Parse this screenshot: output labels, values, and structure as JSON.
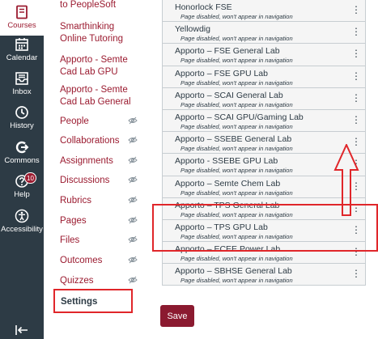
{
  "global_nav": {
    "items": [
      {
        "label": "Courses",
        "icon": "book-icon",
        "active": true
      },
      {
        "label": "Calendar",
        "icon": "calendar-icon"
      },
      {
        "label": "Inbox",
        "icon": "inbox-icon"
      },
      {
        "label": "History",
        "icon": "clock-icon"
      },
      {
        "label": "Commons",
        "icon": "commons-icon"
      },
      {
        "label": "Help",
        "icon": "help-icon",
        "badge": "10"
      },
      {
        "label": "Accessibility",
        "icon": "accessibility-icon"
      }
    ],
    "collapse_icon": "collapse-arrow-icon"
  },
  "course_nav": {
    "items": [
      {
        "label": "to PeopleSoft"
      },
      {
        "label": "Smarthinking Online Tutoring"
      },
      {
        "label": "Apporto - Semte Cad Lab GPU"
      },
      {
        "label": "Apporto - Semte Cad Lab General"
      },
      {
        "label": "People",
        "hidden": true
      },
      {
        "label": "Collaborations",
        "hidden": true
      },
      {
        "label": "Assignments",
        "hidden": true
      },
      {
        "label": "Discussions",
        "hidden": true
      },
      {
        "label": "Rubrics",
        "hidden": true
      },
      {
        "label": "Pages",
        "hidden": true
      },
      {
        "label": "Files",
        "hidden": true
      },
      {
        "label": "Outcomes",
        "hidden": true
      },
      {
        "label": "Quizzes",
        "hidden": true
      },
      {
        "label": "Settings",
        "active": true
      }
    ]
  },
  "disabled_note": "Page disabled, won't appear in navigation",
  "labs": [
    {
      "name": "Honorlock FSE"
    },
    {
      "name": "Yellowdig"
    },
    {
      "name": "Apporto – FSE General Lab"
    },
    {
      "name": "Apporto – FSE GPU Lab"
    },
    {
      "name": "Apporto – SCAI General Lab"
    },
    {
      "name": "Apporto – SCAI GPU/Gaming Lab"
    },
    {
      "name": "Apporto – SSEBE General Lab"
    },
    {
      "name": "Apporto - SSEBE GPU Lab"
    },
    {
      "name": "Apporto – Semte Chem Lab"
    },
    {
      "name": "Apporto – TPS General Lab"
    },
    {
      "name": "Apporto – TPS GPU Lab"
    },
    {
      "name": "Apporto – ECEE Power Lab"
    },
    {
      "name": "Apporto – SBHSE General Lab"
    }
  ],
  "save_label": "Save",
  "colors": {
    "brand": "#9b1b30",
    "nav_bg": "#2d3b45",
    "highlight": "#e0262a"
  }
}
